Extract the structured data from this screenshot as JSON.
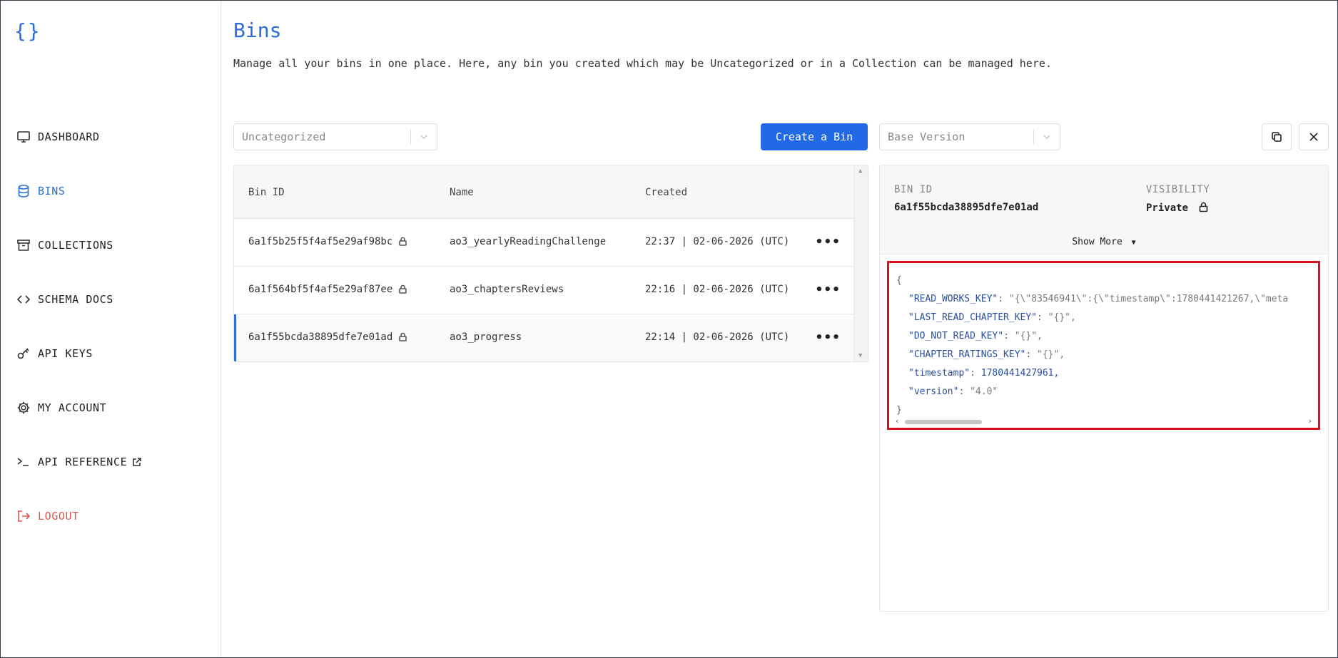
{
  "logo": "{}",
  "sidebar": {
    "items": [
      {
        "label": "DASHBOARD",
        "icon": "monitor-icon"
      },
      {
        "label": "BINS",
        "icon": "database-icon"
      },
      {
        "label": "COLLECTIONS",
        "icon": "archive-icon"
      },
      {
        "label": "SCHEMA DOCS",
        "icon": "code-icon"
      },
      {
        "label": "API KEYS",
        "icon": "key-icon"
      },
      {
        "label": "MY ACCOUNT",
        "icon": "gear-icon"
      },
      {
        "label": "API REFERENCE",
        "icon": "terminal-icon"
      },
      {
        "label": "LOGOUT",
        "icon": "logout-icon"
      }
    ],
    "active": "BINS"
  },
  "page": {
    "title": "Bins",
    "subtitle": "Manage all your bins in one place. Here, any bin you created which may be Uncategorized or in a Collection can be managed here."
  },
  "toolbar": {
    "collection_select": "Uncategorized",
    "create_label": "Create a Bin",
    "version_select": "Base Version"
  },
  "table": {
    "headers": [
      "Bin ID",
      "Name",
      "Created"
    ],
    "rows": [
      {
        "id": "6a1f5b25f5f4af5e29af98bc",
        "name": "ao3_yearlyReadingChallenge",
        "created": "22:37 | 02-06-2026 (UTC)"
      },
      {
        "id": "6a1f564bf5f4af5e29af87ee",
        "name": "ao3_chaptersReviews",
        "created": "22:16 | 02-06-2026 (UTC)"
      },
      {
        "id": "6a1f55bcda38895dfe7e01ad",
        "name": "ao3_progress",
        "created": "22:14 | 02-06-2026 (UTC)"
      }
    ]
  },
  "detail": {
    "bin_id_label": "BIN ID",
    "bin_id": "6a1f55bcda38895dfe7e01ad",
    "visibility_label": "VISIBILITY",
    "visibility": "Private",
    "show_more": "Show More"
  },
  "json_view": {
    "open": "{",
    "lines": [
      {
        "key": "\"READ_WORKS_KEY\"",
        "value": "\"{\\\"83546941\\\":{\\\"timestamp\\\":1780441421267,\\\"meta"
      },
      {
        "key": "\"LAST_READ_CHAPTER_KEY\"",
        "value": "\"{}\","
      },
      {
        "key": "\"DO_NOT_READ_KEY\"",
        "value": "\"{}\","
      },
      {
        "key": "\"CHAPTER_RATINGS_KEY\"",
        "value": "\"{}\","
      },
      {
        "key": "\"timestamp\"",
        "value": "1780441427961,"
      },
      {
        "key": "\"version\"",
        "value": "\"4.0\""
      }
    ],
    "close": "}"
  },
  "colors": {
    "accent": "#2c6ed8",
    "primary_button": "#2269e6",
    "logout": "#e0574f",
    "highlight_border": "#d6111b"
  }
}
